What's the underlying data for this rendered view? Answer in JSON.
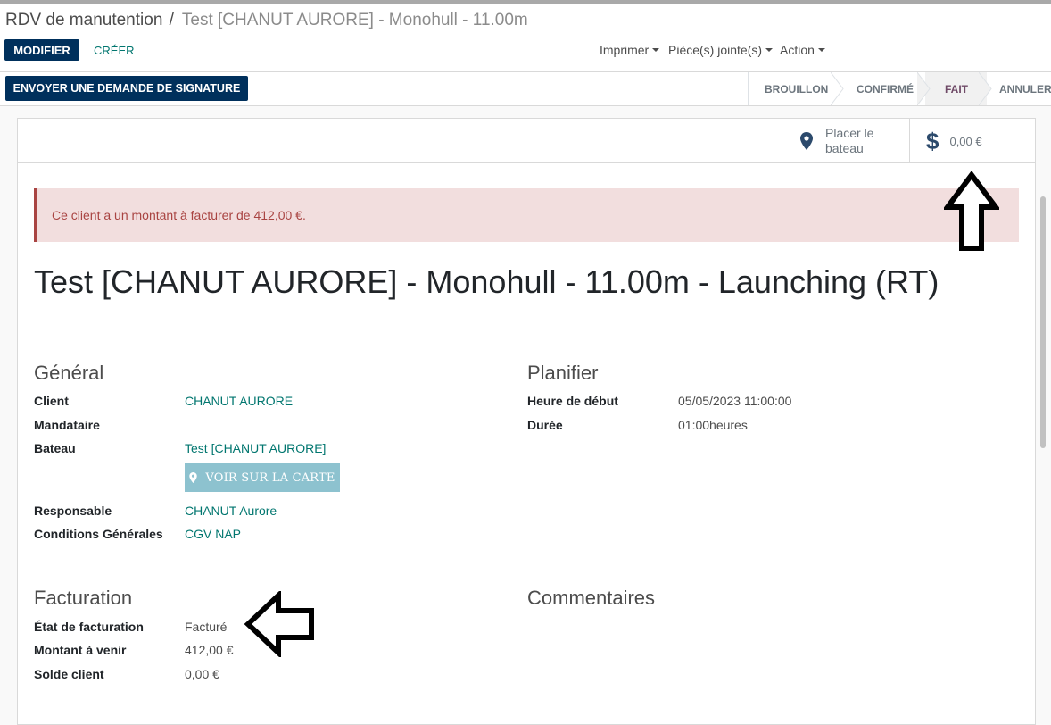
{
  "breadcrumb": {
    "parent": "RDV de manutention",
    "separator": "/",
    "current": "Test [CHANUT AURORE] - Monohull - 11.00m"
  },
  "toolbar": {
    "edit_label": "MODIFIER",
    "create_label": "CRÉER",
    "print_label": "Imprimer",
    "attachments_label": "Pièce(s) jointe(s)",
    "action_label": "Action"
  },
  "header": {
    "signature_label": "ENVOYER UNE DEMANDE DE SIGNATURE",
    "stages": [
      {
        "label": "BROUILLON",
        "active": false
      },
      {
        "label": "CONFIRMÉ",
        "active": false
      },
      {
        "label": "FAIT",
        "active": true
      },
      {
        "label": "ANNULER",
        "active": false
      }
    ]
  },
  "smart_buttons": {
    "place_boat_line1": "Placer le",
    "place_boat_line2": "bateau",
    "amount": "0,00 €"
  },
  "alert": {
    "text": "Ce client a un montant à facturer de 412,00 €."
  },
  "record": {
    "title": "Test [CHANUT AURORE] - Monohull - 11.00m - Launching (RT)"
  },
  "general": {
    "heading": "Général",
    "client_label": "Client",
    "client_value": "CHANUT AURORE",
    "agent_label": "Mandataire",
    "boat_label": "Bateau",
    "boat_value": "Test [CHANUT AURORE]",
    "map_button": "VOIR SUR LA CARTE",
    "manager_label": "Responsable",
    "manager_value": "CHANUT Aurore",
    "terms_label": "Conditions Générales",
    "terms_value": "CGV NAP"
  },
  "planning": {
    "heading": "Planifier",
    "start_label": "Heure de début",
    "start_value": "05/05/2023 11:00:00",
    "duration_label": "Durée",
    "duration_value": "01:00heures"
  },
  "billing": {
    "heading": "Facturation",
    "state_label": "État de facturation",
    "state_value": "Facturé",
    "upcoming_label": "Montant à venir",
    "upcoming_value": "412,00 €",
    "balance_label": "Solde client",
    "balance_value": "0,00 €"
  },
  "comments": {
    "heading": "Commentaires"
  },
  "colors": {
    "primary": "#00305c",
    "link": "#01766f",
    "alert_bg": "#f2dede",
    "alert_text": "#a94442",
    "active_stage": "#6f4a67"
  }
}
